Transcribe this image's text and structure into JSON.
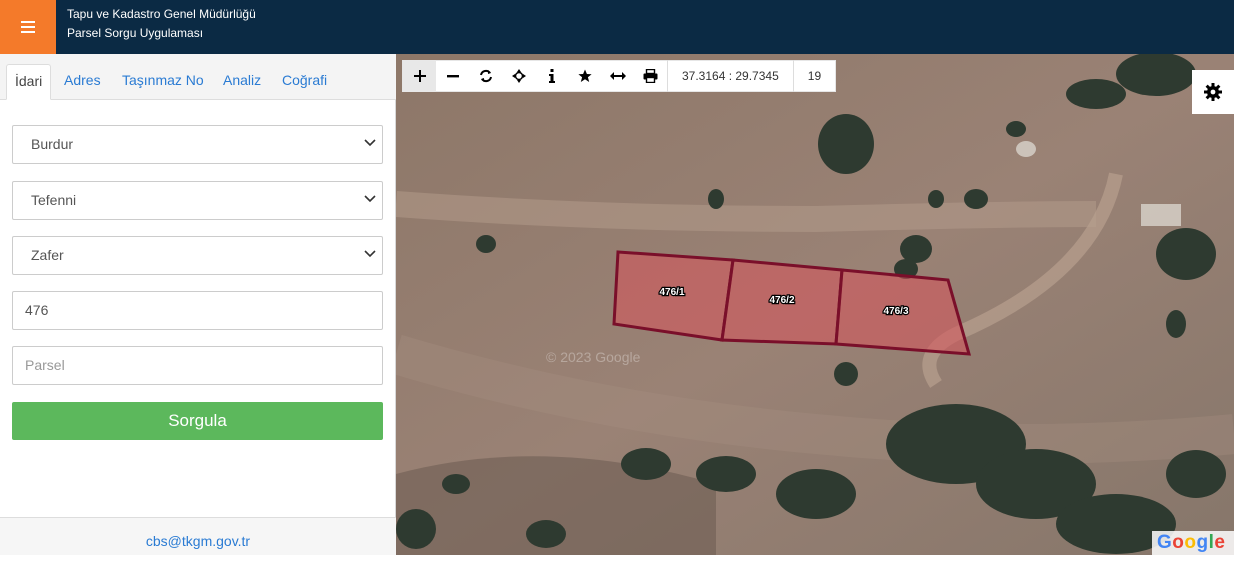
{
  "header": {
    "org": "Tapu ve Kadastro Genel Müdürlüğü",
    "app": "Parsel Sorgu Uygulaması",
    "menu_icon": "hamburger-icon"
  },
  "tabs": [
    "İdari",
    "Adres",
    "Taşınmaz No",
    "Analiz",
    "Coğrafi"
  ],
  "form": {
    "il": "Burdur",
    "ilce": "Tefenni",
    "mahalle": "Zafer",
    "ada": "476",
    "parsel_placeholder": "Parsel",
    "submit": "Sorgula"
  },
  "footer": {
    "email": "cbs@tkgm.gov.tr"
  },
  "map": {
    "toolbar_icons": [
      "plus-icon",
      "minus-icon",
      "refresh-icon",
      "crosshair-icon",
      "info-icon",
      "star-icon",
      "measure-icon",
      "print-icon"
    ],
    "coordinate": "37.3164 : 29.7345",
    "zoom": "19",
    "parcels": [
      "476/1",
      "476/2",
      "476/3"
    ],
    "watermark": "© 2023 Google",
    "attribution": "Google",
    "colors": {
      "parcel_fill": "#d9535b",
      "parcel_stroke": "#7a0f2a"
    }
  },
  "colors": {
    "header_bg": "#0b2a44",
    "menu_bg": "#f47a2a",
    "button_bg": "#5cb85c",
    "link": "#2a7bd3"
  }
}
